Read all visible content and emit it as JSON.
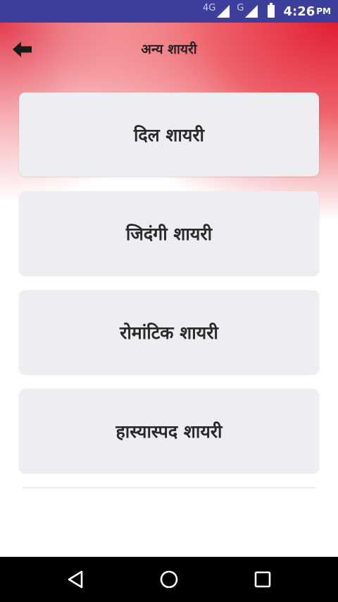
{
  "status_bar": {
    "network_1": "4G",
    "network_2": "G",
    "time": "4:26",
    "ampm": "PM"
  },
  "app_bar": {
    "title": "अन्य शायरी",
    "back_icon": "arrow-left-icon"
  },
  "categories": [
    {
      "label": "दिल शायरी"
    },
    {
      "label": "जिदंगी शायरी"
    },
    {
      "label": "रोमांटिक शायरी"
    },
    {
      "label": "हास्यास्पद शायरी"
    }
  ],
  "nav_bar": {
    "icons": [
      "back-triangle-icon",
      "home-circle-icon",
      "recents-square-icon"
    ]
  },
  "colors": {
    "status_bar": "#3c3f9c",
    "accent_red": "#e11e32",
    "card_bg": "#eceef1",
    "nav_bar": "#000000"
  }
}
